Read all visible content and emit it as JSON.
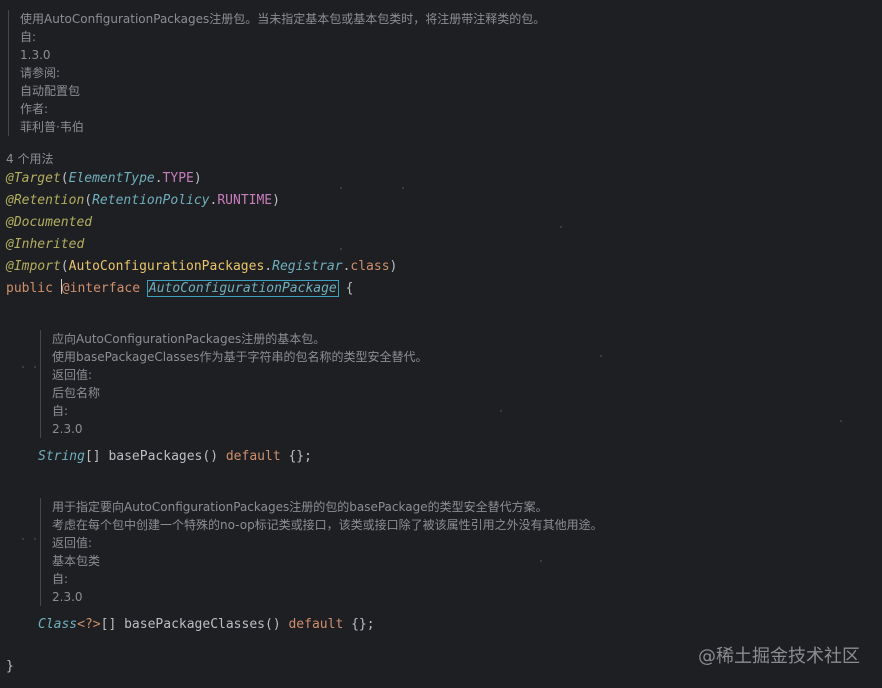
{
  "class_doc": {
    "lines": [
      "使用AutoConfigurationPackages注册包。当未指定基本包或基本包类时，将注册带注释类的包。",
      "自:",
      "1.3.0",
      "请参阅:",
      "自动配置包",
      "作者:",
      "菲利普·韦伯"
    ]
  },
  "usages": "4 个用法",
  "code": {
    "target": {
      "annotation": "@Target",
      "open": "(",
      "type": "ElementType",
      "dot": ".",
      "value": "TYPE",
      "close": ")"
    },
    "retention": {
      "annotation": "@Retention",
      "open": "(",
      "type": "RetentionPolicy",
      "dot": ".",
      "value": "RUNTIME",
      "close": ")"
    },
    "documented": "@Documented",
    "inherited": "@Inherited",
    "import": {
      "annotation": "@Import",
      "open": "(",
      "type": "AutoConfigurationPackages",
      "dot1": ".",
      "inner": "Registrar",
      "dot2": ".",
      "keyword": "class",
      "close": ")"
    },
    "declaration": {
      "public": "public",
      "at": "@",
      "interface": "interface",
      "name": "AutoConfigurationPackage",
      "brace": "{"
    },
    "method1": {
      "type": "String",
      "brackets": "[]",
      "name": "basePackages",
      "parens": "()",
      "default": "default",
      "value": "{};"
    },
    "method2": {
      "type": "Class",
      "generic": "<?>",
      "brackets": "[]",
      "name": "basePackageClasses",
      "parens": "()",
      "default": "default",
      "value": "{};"
    },
    "closing_brace": "}"
  },
  "method1_doc": {
    "lines": [
      "应向AutoConfigurationPackages注册的基本包。",
      "使用basePackageClasses作为基于字符串的包名称的类型安全替代。",
      "返回值:",
      "后包名称",
      "自:",
      "2.3.0"
    ]
  },
  "method2_doc": {
    "lines": [
      "用于指定要向AutoConfigurationPackages注册的包的basePackage的类型安全替代方案。",
      "考虑在每个包中创建一个特殊的no-op标记类或接口，该类或接口除了被该属性引用之外没有其他用途。",
      "返回值:",
      "基本包类",
      "自:",
      "2.3.0"
    ]
  },
  "watermark": "@稀土掘金技术社区",
  "colors": {
    "background": "#1e1f22",
    "annotation": "#b3ae60",
    "class_name": "#6fafbd",
    "keyword": "#cf8e6d",
    "constant": "#c77dbb",
    "doc_text": "#8c8e94"
  }
}
